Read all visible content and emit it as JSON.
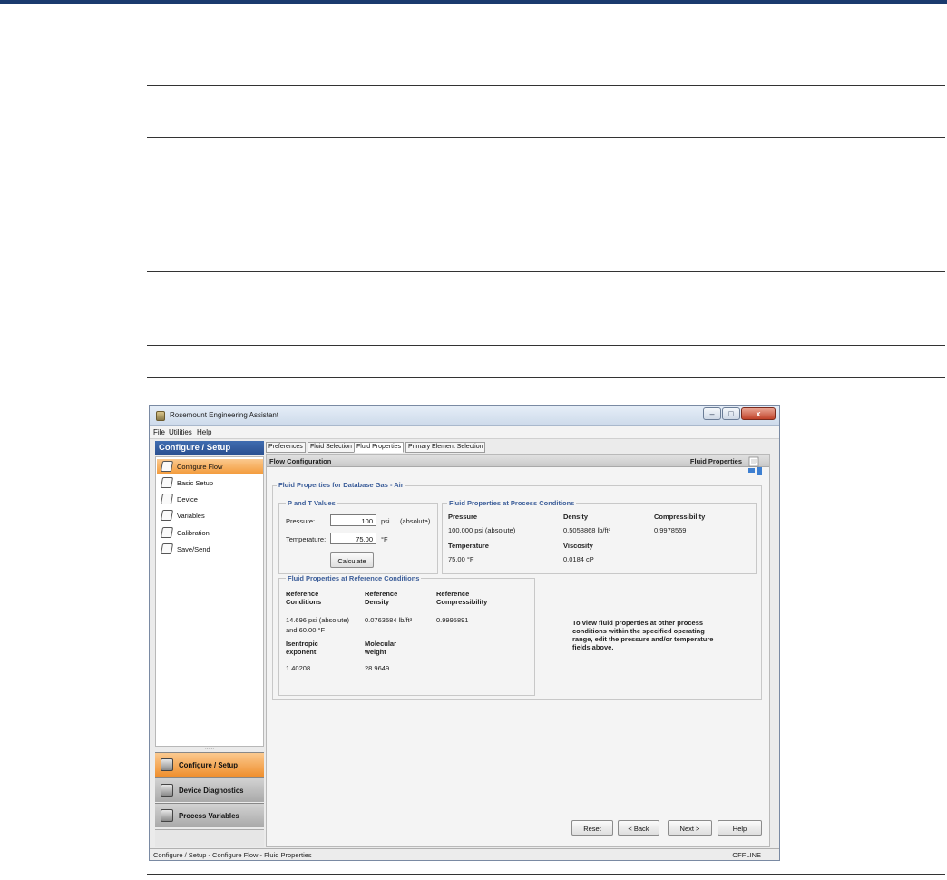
{
  "window": {
    "title": "Rosemount Engineering Assistant",
    "min": "–",
    "max": "□",
    "close": "x"
  },
  "menu": [
    "File",
    "Utilities",
    "Help"
  ],
  "nav": {
    "header": "Configure / Setup",
    "items": [
      {
        "label": "Configure Flow",
        "icon": "configure-flow-icon",
        "active": true
      },
      {
        "label": "Basic Setup",
        "icon": "basic-setup-icon"
      },
      {
        "label": "Device",
        "icon": "device-icon"
      },
      {
        "label": "Variables",
        "icon": "variables-icon"
      },
      {
        "label": "Calibration",
        "icon": "calibration-icon"
      },
      {
        "label": "Save/Send",
        "icon": "save-send-icon"
      }
    ],
    "grip": "......",
    "sections": [
      {
        "label": "Configure / Setup",
        "icon": "configure-setup-icon",
        "active": true
      },
      {
        "label": "Device Diagnostics",
        "icon": "device-diagnostics-icon"
      },
      {
        "label": "Process Variables",
        "icon": "process-variables-icon"
      }
    ]
  },
  "tabs": [
    "Preferences",
    "Fluid Selection",
    "Fluid Properties",
    "Primary Element Selection"
  ],
  "active_tab": "Fluid Properties",
  "content": {
    "header_left": "Flow Configuration",
    "header_right": "Fluid Properties",
    "main_group_title": "Fluid Properties for Database Gas - Air",
    "pt": {
      "title": "P and T Values",
      "pressure_label": "Pressure:",
      "pressure_value": "100",
      "pressure_unit": "psi",
      "pressure_qualifier": "(absolute)",
      "temperature_label": "Temperature:",
      "temperature_value": "75.00",
      "temperature_unit": "°F",
      "calculate": "Calculate"
    },
    "process": {
      "title": "Fluid Properties at Process Conditions",
      "pressure_h": "Pressure",
      "pressure_v": "100.000 psi (absolute)",
      "density_h": "Density",
      "density_v": "0.5058868 lb/ft³",
      "compress_h": "Compressibility",
      "compress_v": "0.9978559",
      "temp_h": "Temperature",
      "temp_v": "75.00 °F",
      "visc_h": "Viscosity",
      "visc_v": "0.0184 cP"
    },
    "reference": {
      "title": "Fluid Properties at Reference Conditions",
      "cond_h1": "Reference",
      "cond_h2": "Conditions",
      "cond_v1": "14.696 psi (absolute)",
      "cond_v2": "and 60.00 °F",
      "dens_h1": "Reference",
      "dens_h2": "Density",
      "dens_v": "0.0763584 lb/ft³",
      "comp_h1": "Reference",
      "comp_h2": "Compressibility",
      "comp_v": "0.9995891",
      "isen_h1": "Isentropic",
      "isen_h2": "exponent",
      "isen_v": "1.40208",
      "mw_h1": "Molecular",
      "mw_h2": "weight",
      "mw_v": "28.9649"
    },
    "note_lines": [
      "To view fluid properties at other process",
      "conditions within the specified operating",
      "range, edit the pressure and/or temperature",
      "fields above."
    ]
  },
  "buttons": {
    "reset": "Reset",
    "back": "< Back",
    "next": "Next >",
    "help": "Help"
  },
  "status": {
    "left": "Configure / Setup - Configure Flow - Fluid Properties",
    "right": "OFFLINE"
  }
}
